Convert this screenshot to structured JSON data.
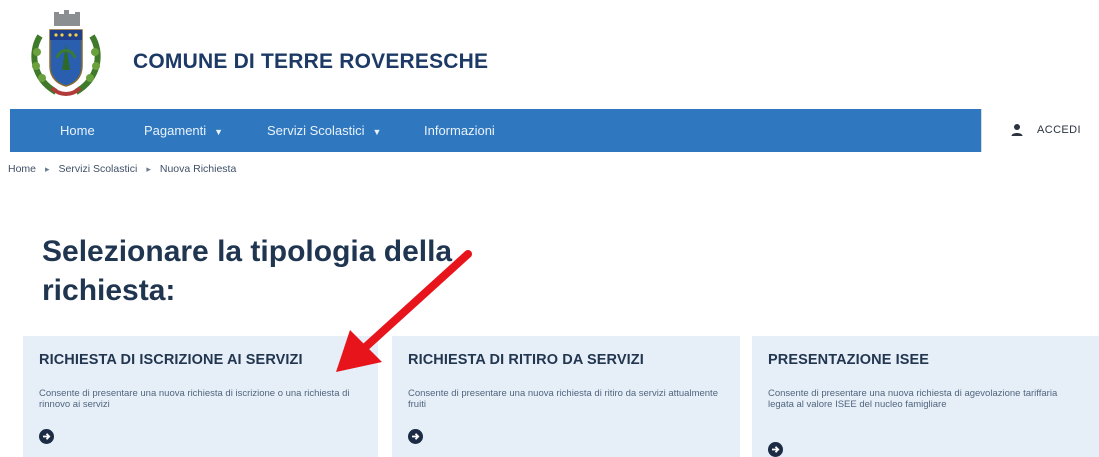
{
  "header": {
    "site_title": "COMUNE DI TERRE ROVERESCHE"
  },
  "navbar": {
    "items": [
      {
        "label": "Home",
        "caret": false
      },
      {
        "label": "Pagamenti",
        "caret": true
      },
      {
        "label": "Servizi Scolastici",
        "caret": true
      },
      {
        "label": "Informazioni",
        "caret": false
      }
    ],
    "login_label": "ACCEDI"
  },
  "breadcrumb": [
    "Home",
    "Servizi Scolastici",
    "Nuova Richiesta"
  ],
  "main": {
    "heading": "Selezionare la tipologia della richiesta:",
    "cards": [
      {
        "title": "RICHIESTA DI ISCRIZIONE AI SERVIZI",
        "description": "Consente di presentare una nuova richiesta di iscrizione o una richiesta di rinnovo ai servizi"
      },
      {
        "title": "RICHIESTA DI RITIRO DA SERVIZI",
        "description": "Consente di presentare una nuova richiesta di ritiro da servizi attualmente fruiti"
      },
      {
        "title": "PRESENTAZIONE ISEE",
        "description": "Consente di presentare una nuova richiesta di agevolazione tariffaria legata al valore ISEE del nucleo famigliare"
      }
    ]
  },
  "colors": {
    "navbar": "#2f78bf",
    "card_background": "#e6eff8",
    "title_text": "#1d3a66",
    "annotation_arrow": "#e8141b"
  }
}
